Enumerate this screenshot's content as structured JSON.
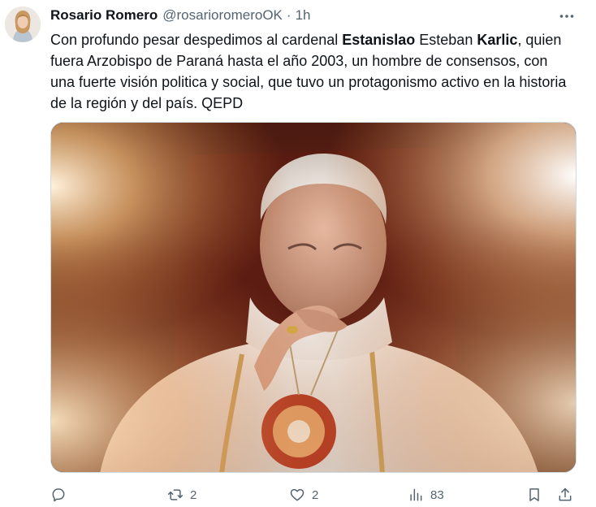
{
  "author": {
    "name": "Rosario Romero",
    "handle": "@rosarioromeroOK",
    "separator": "·",
    "time": "1h"
  },
  "tweet": {
    "text_1": "Con profundo pesar despedimos al cardenal ",
    "bold_1": "Estanislao",
    "text_2": " Esteban ",
    "bold_2": "Karlic",
    "text_3": ", quien fuera Arzobispo de Paraná hasta el año 2003, un hombre de consensos, con una fuerte visión politica y social, que tuvo un protagonismo activo en la historia de la región y del país. QEPD"
  },
  "media": {
    "image_name": "cardinal-portrait-photo"
  },
  "actions": {
    "reply_count": "",
    "retweet_count": "2",
    "like_count": "2",
    "views_count": "83"
  },
  "icons": {
    "more": "more-horizontal-icon",
    "reply": "reply-icon",
    "retweet": "retweet-icon",
    "like": "heart-icon",
    "views": "views-chart-icon",
    "bookmark": "bookmark-icon",
    "share": "share-icon"
  },
  "colors": {
    "text": "#0f1419",
    "secondary": "#536471",
    "border": "#cfd9de"
  }
}
